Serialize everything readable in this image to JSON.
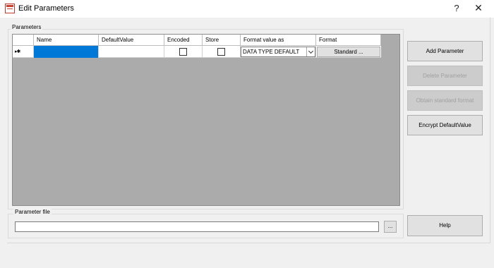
{
  "window": {
    "title": "Edit Parameters",
    "help_label": "?",
    "close_label": "✕"
  },
  "parameters_group": {
    "label": "Parameters",
    "columns": [
      "Name",
      "DefaultValue",
      "Encoded",
      "Store",
      "Format value as",
      "Format"
    ],
    "rows": [
      {
        "indicator": "▸✱",
        "name": "",
        "default_value": "",
        "encoded": false,
        "store": false,
        "format_value_as": "DATA TYPE DEFAULT",
        "format_button": "Standard ..."
      }
    ]
  },
  "buttons": {
    "add_parameter": "Add Parameter",
    "delete_parameter": "Delete Parameter",
    "obtain_standard_format": "Obtain standard format",
    "encrypt_default_value": "Encrypt DefaultValue",
    "help": "Help"
  },
  "parameter_file": {
    "label": "Parameter file",
    "value": "",
    "browse_label": "..."
  },
  "colors": {
    "selection": "#0078d7",
    "grid_background": "#ababab",
    "dialog_background": "#f0f0f0"
  }
}
